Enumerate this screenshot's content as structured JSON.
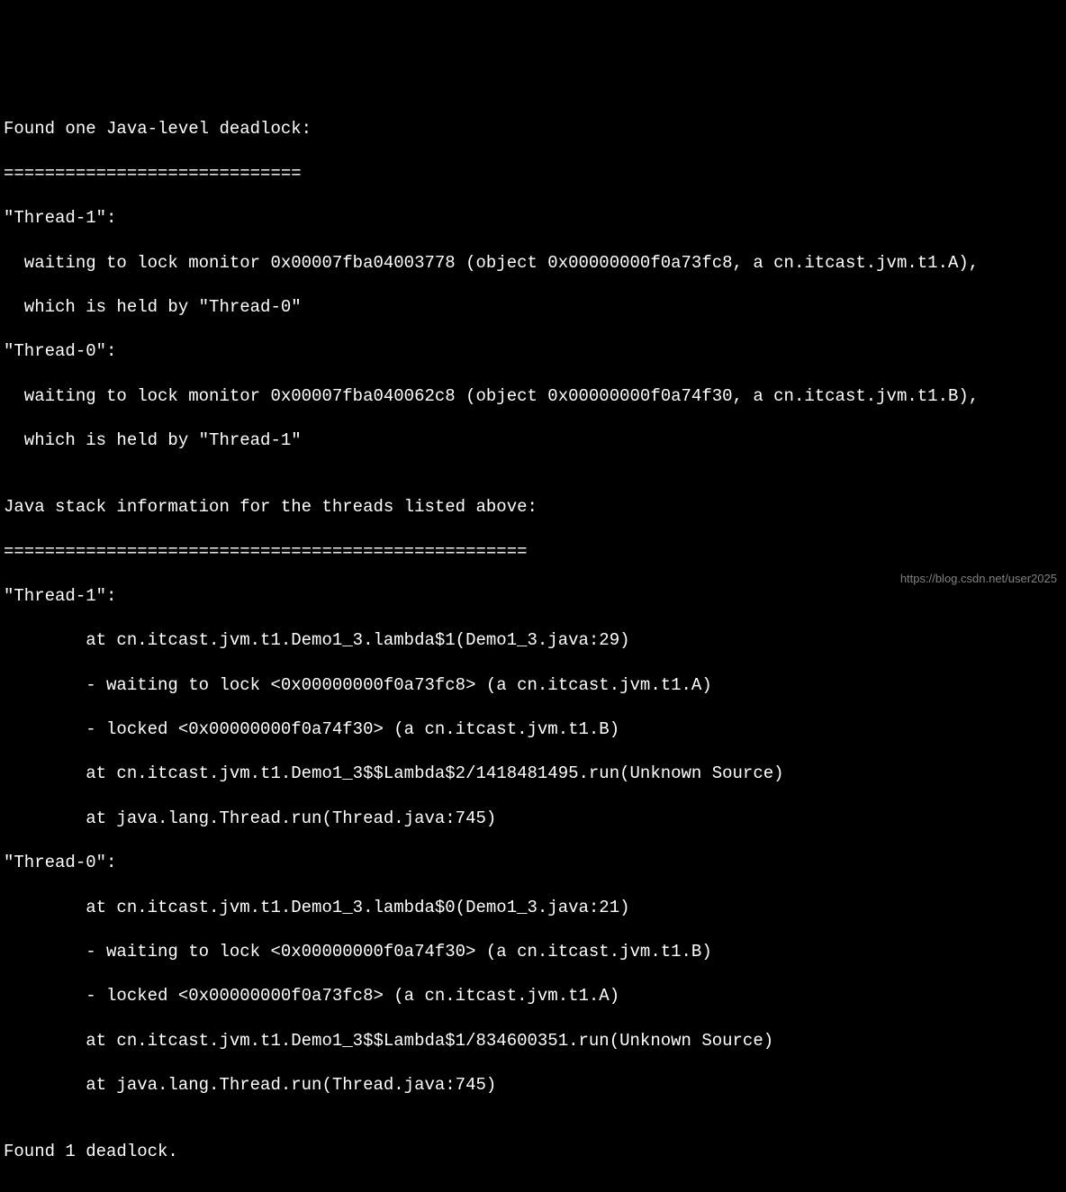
{
  "terminal": {
    "lines": [
      "Found one Java-level deadlock:",
      "=============================",
      "\"Thread-1\":",
      "  waiting to lock monitor 0x00007fba04003778 (object 0x00000000f0a73fc8, a cn.itcast.jvm.t1.A),",
      "  which is held by \"Thread-0\"",
      "\"Thread-0\":",
      "  waiting to lock monitor 0x00007fba040062c8 (object 0x00000000f0a74f30, a cn.itcast.jvm.t1.B),",
      "  which is held by \"Thread-1\"",
      "",
      "Java stack information for the threads listed above:",
      "===================================================",
      "\"Thread-1\":",
      "        at cn.itcast.jvm.t1.Demo1_3.lambda$1(Demo1_3.java:29)",
      "        - waiting to lock <0x00000000f0a73fc8> (a cn.itcast.jvm.t1.A)",
      "        - locked <0x00000000f0a74f30> (a cn.itcast.jvm.t1.B)",
      "        at cn.itcast.jvm.t1.Demo1_3$$Lambda$2/1418481495.run(Unknown Source)",
      "        at java.lang.Thread.run(Thread.java:745)",
      "\"Thread-0\":",
      "        at cn.itcast.jvm.t1.Demo1_3.lambda$0(Demo1_3.java:21)",
      "        - waiting to lock <0x00000000f0a74f30> (a cn.itcast.jvm.t1.B)",
      "        - locked <0x00000000f0a73fc8> (a cn.itcast.jvm.t1.A)",
      "        at cn.itcast.jvm.t1.Demo1_3$$Lambda$1/834600351.run(Unknown Source)",
      "        at java.lang.Thread.run(Thread.java:745)",
      "",
      "Found 1 deadlock."
    ]
  },
  "watermark": "https://blog.csdn.net/user2025"
}
